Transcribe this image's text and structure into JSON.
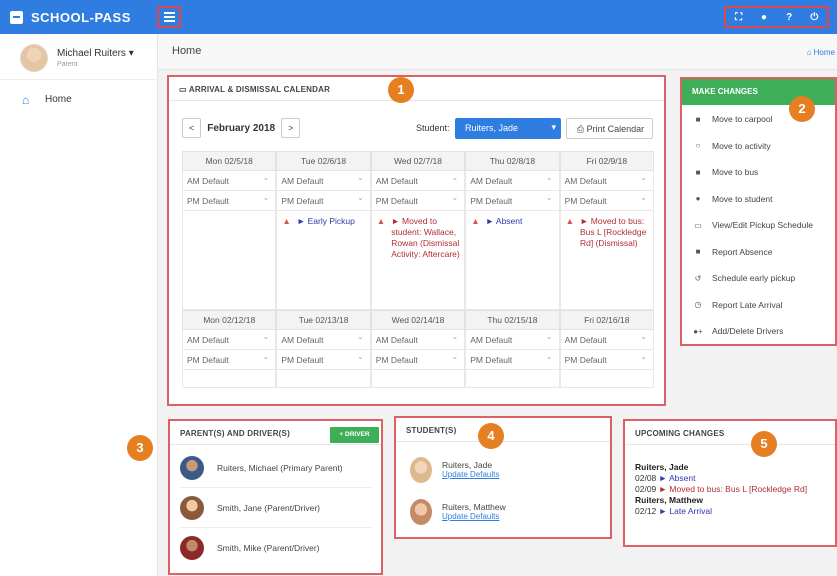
{
  "app": {
    "brand": "SCHOOL-PASS"
  },
  "user": {
    "name": "Michael Ruiters ▾",
    "role": "Parent"
  },
  "nav": {
    "home_label": "Home"
  },
  "page": {
    "title": "Home",
    "breadcrumb": "Home"
  },
  "calendar": {
    "title": "ARRIVAL & DISMISSAL CALENDAR",
    "prev_label": "<",
    "next_label": ">",
    "month": "February 2018",
    "student_label": "Student:",
    "student_value": "Ruiters, Jade",
    "print_label": "Print Calendar",
    "am_default": "AM Default",
    "pm_default": "PM Default",
    "week1": [
      {
        "date": "Mon 02/5/18",
        "event": "",
        "event_color": ""
      },
      {
        "date": "Tue 02/6/18",
        "event": "► Early Pickup",
        "event_color": "blue"
      },
      {
        "date": "Wed 02/7/18",
        "event": "► Moved to student: Wallace, Rowan (Dismissal Activity: Aftercare)",
        "event_color": "red"
      },
      {
        "date": "Thu 02/8/18",
        "event": "► Absent",
        "event_color": "blue"
      },
      {
        "date": "Fri 02/9/18",
        "event": "► Moved to bus: Bus L [Rockledge Rd] (Dismissal)",
        "event_color": "red"
      }
    ],
    "week2": [
      {
        "date": "Mon 02/12/18"
      },
      {
        "date": "Tue 02/13/18"
      },
      {
        "date": "Wed 02/14/18"
      },
      {
        "date": "Thu 02/15/18"
      },
      {
        "date": "Fri 02/16/18"
      }
    ]
  },
  "changes": {
    "title": "MAKE CHANGES",
    "items": [
      {
        "label": "Move to carpool",
        "icon": "car-icon"
      },
      {
        "label": "Move to activity",
        "icon": "comment-icon"
      },
      {
        "label": "Move to bus",
        "icon": "bus-icon"
      },
      {
        "label": "Move to student",
        "icon": "person-icon"
      },
      {
        "label": "View/Edit Pickup Schedule",
        "icon": "calendar-icon"
      },
      {
        "label": "Report Absence",
        "icon": "absence-icon"
      },
      {
        "label": "Schedule early pickup",
        "icon": "history-icon"
      },
      {
        "label": "Report Late Arrival",
        "icon": "clock-icon"
      },
      {
        "label": "Add/Delete Drivers",
        "icon": "user-plus-icon"
      }
    ]
  },
  "parents": {
    "title": "PARENT(S) AND DRIVER(S)",
    "driver_button": "DRIVER",
    "list": [
      {
        "name": "Ruiters, Michael (Primary Parent)"
      },
      {
        "name": "Smith, Jane (Parent/Driver)"
      },
      {
        "name": "Smith, Mike (Parent/Driver)"
      }
    ]
  },
  "students": {
    "title": "STUDENT(S)",
    "list": [
      {
        "name": "Ruiters, Jade",
        "link": "Update Defaults"
      },
      {
        "name": "Ruiters, Matthew",
        "link": "Update Defaults"
      }
    ]
  },
  "upcoming": {
    "title": "UPCOMING CHANGES",
    "s1_name": "Ruiters, Jade",
    "s1_c1_date": "02/08",
    "s1_c1_text": "► Absent",
    "s1_c2_date": "02/09",
    "s1_c2_text": "► Moved to bus: Bus L [Rockledge Rd]",
    "s2_name": "Ruiters, Matthew",
    "s2_c1_date": "02/12",
    "s2_c1_text": "► Late Arrival"
  },
  "badges": [
    "1",
    "2",
    "3",
    "4",
    "5"
  ],
  "colors": {
    "primary": "#2f7de1",
    "success": "#3eae58",
    "highlight": "#df6064",
    "badge": "#e67e22"
  }
}
